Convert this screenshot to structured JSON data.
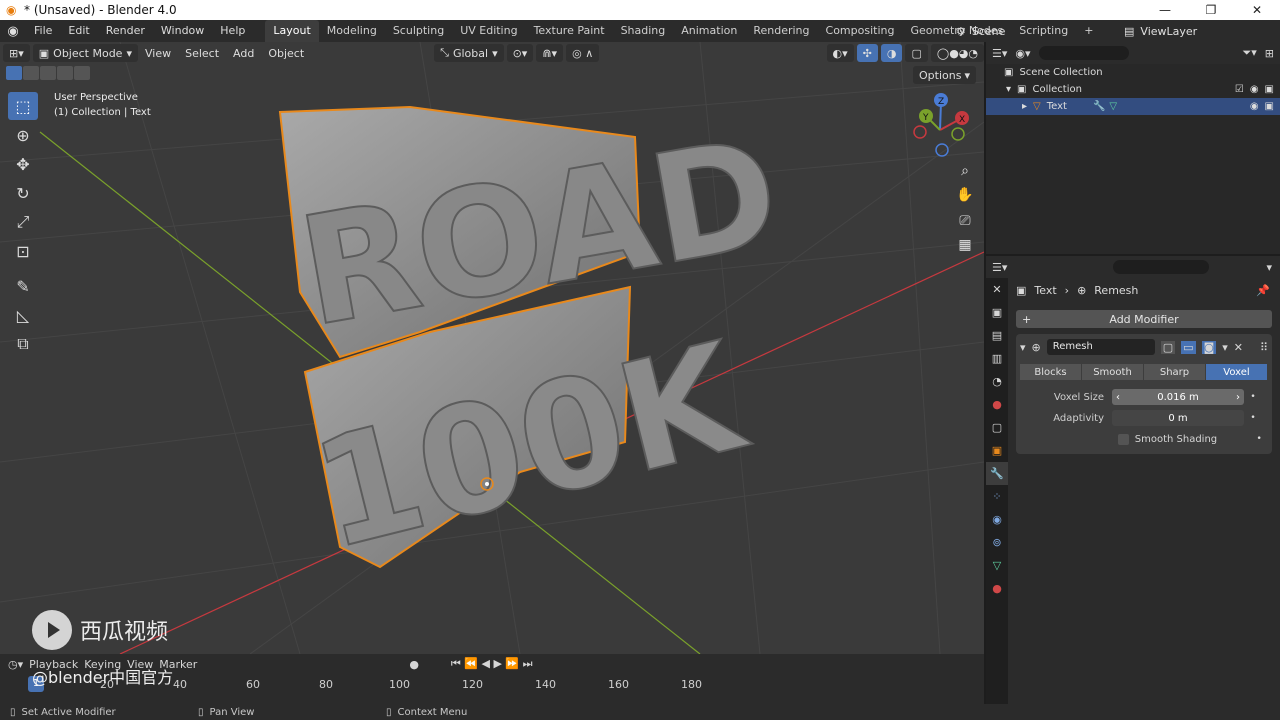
{
  "window": {
    "title": "* (Unsaved) - Blender 4.0",
    "controls": [
      "—",
      "❐",
      "✕"
    ]
  },
  "menus": [
    "File",
    "Edit",
    "Render",
    "Window",
    "Help"
  ],
  "workspace_tabs": [
    "Layout",
    "Modeling",
    "Sculpting",
    "UV Editing",
    "Texture Paint",
    "Shading",
    "Animation",
    "Rendering",
    "Compositing",
    "Geometry Nodes",
    "Scripting"
  ],
  "active_workspace": "Layout",
  "scene": "Scene",
  "view_layer": "ViewLayer",
  "viewport": {
    "mode": "Object Mode",
    "menus": [
      "View",
      "Select",
      "Add",
      "Object"
    ],
    "orientation": "Global",
    "options": "Options",
    "info_line1": "User Perspective",
    "info_line2": "(1) Collection | Text",
    "text_line1": "ROAD",
    "text_line2": "100K",
    "gizmo_axes": [
      "Z",
      "Y",
      "X"
    ]
  },
  "outliner": {
    "rows": [
      "Scene Collection",
      "Collection",
      "Text"
    ]
  },
  "properties": {
    "breadcrumb_object": "Text",
    "breadcrumb_modifier": "Remesh",
    "add_modifier": "Add Modifier",
    "modifier_name": "Remesh",
    "modes": [
      "Blocks",
      "Smooth",
      "Sharp",
      "Voxel"
    ],
    "active_mode": "Voxel",
    "voxel_size_label": "Voxel Size",
    "voxel_size_value": "0.016 m",
    "adaptivity_label": "Adaptivity",
    "adaptivity_value": "0 m",
    "smooth_shading_label": "Smooth Shading"
  },
  "timeline": {
    "menus": [
      "Playback",
      "Keying",
      "View",
      "Marker"
    ],
    "current_frame": "1",
    "ticks": [
      "20",
      "40",
      "60",
      "80",
      "100",
      "120",
      "140",
      "160",
      "180"
    ]
  },
  "statusbar": [
    "Set Active Modifier",
    "Pan View",
    "Context Menu"
  ],
  "watermark": {
    "brand": "西瓜视频",
    "handle": "@blender中国官方"
  },
  "colors": {
    "accent": "#4772b3",
    "selection_outline": "#e8891c",
    "viewport_bg": "#3a3a3a",
    "axis_x": "#c6393f",
    "axis_y": "#7aa12b"
  }
}
